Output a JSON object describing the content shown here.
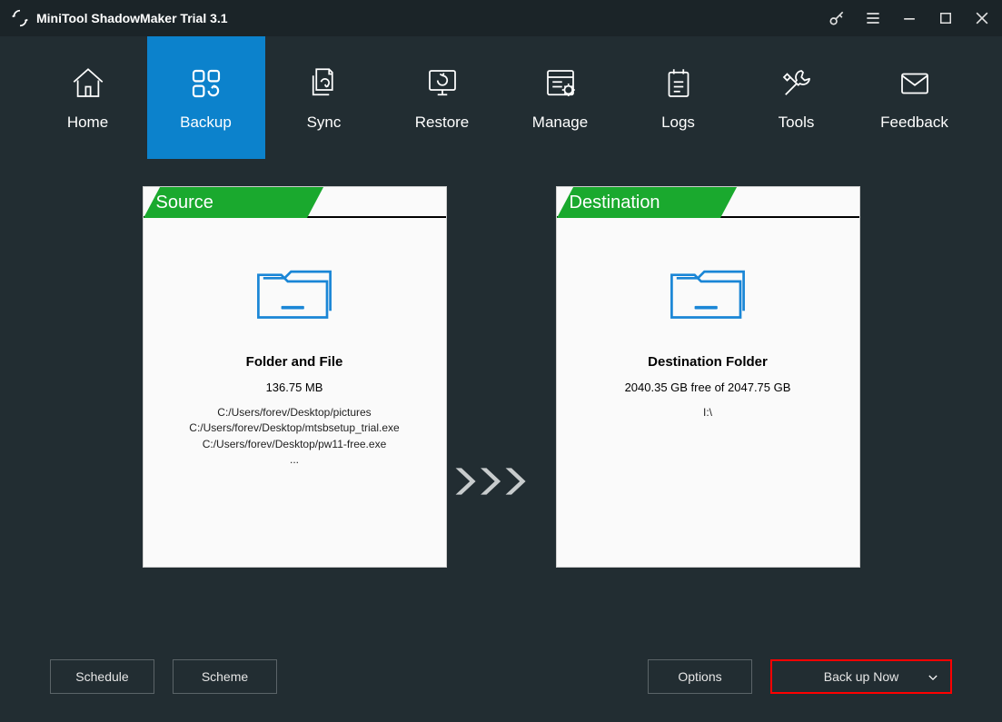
{
  "window": {
    "title": "MiniTool ShadowMaker Trial 3.1"
  },
  "nav": {
    "items": [
      {
        "label": "Home"
      },
      {
        "label": "Backup"
      },
      {
        "label": "Sync"
      },
      {
        "label": "Restore"
      },
      {
        "label": "Manage"
      },
      {
        "label": "Logs"
      },
      {
        "label": "Tools"
      },
      {
        "label": "Feedback"
      }
    ],
    "active_index": 1
  },
  "source": {
    "header": "Source",
    "title": "Folder and File",
    "size": "136.75 MB",
    "paths": [
      "C:/Users/forev/Desktop/pictures",
      "C:/Users/forev/Desktop/mtsbsetup_trial.exe",
      "C:/Users/forev/Desktop/pw11-free.exe",
      "..."
    ]
  },
  "destination": {
    "header": "Destination",
    "title": "Destination Folder",
    "free": "2040.35 GB free of 2047.75 GB",
    "path": "I:\\"
  },
  "buttons": {
    "schedule": "Schedule",
    "scheme": "Scheme",
    "options": "Options",
    "backup_now": "Back up Now"
  }
}
